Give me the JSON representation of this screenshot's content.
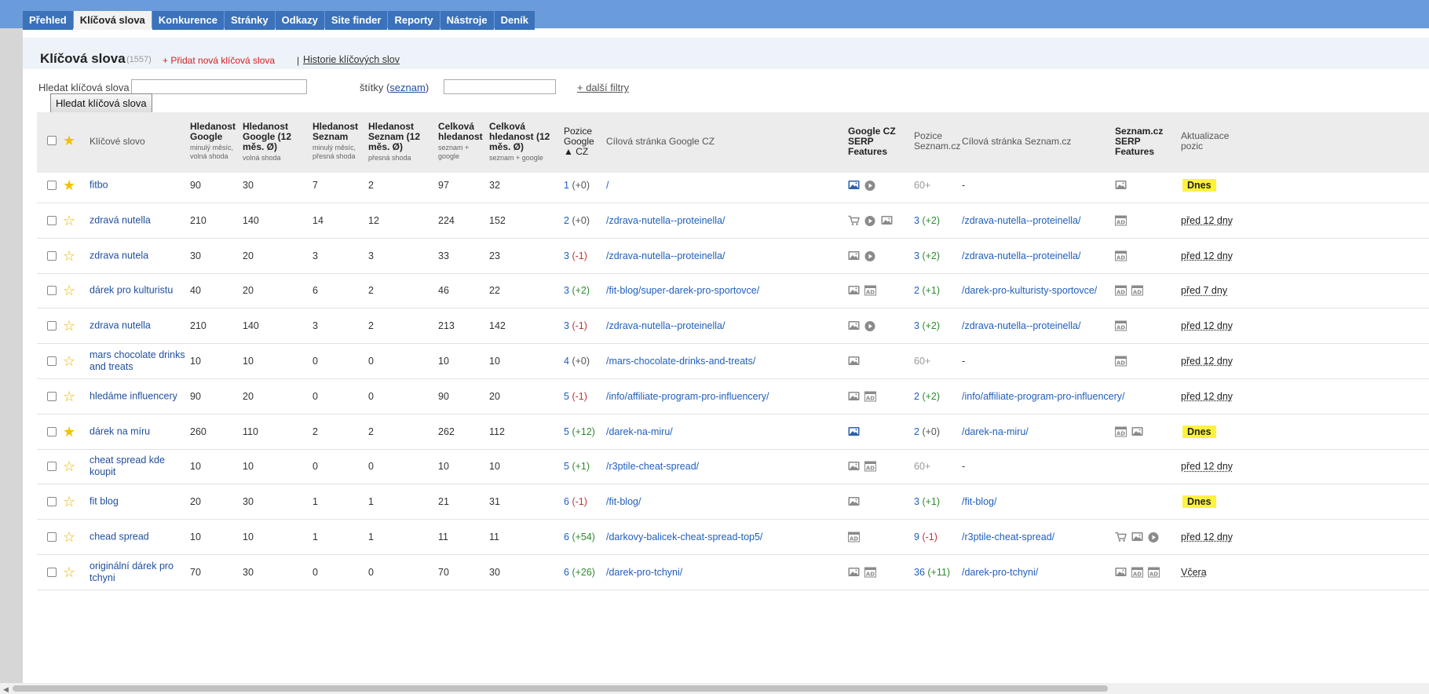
{
  "tabs": [
    {
      "label": "Přehled"
    },
    {
      "label": "Klíčová slova"
    },
    {
      "label": "Konkurence"
    },
    {
      "label": "Stránky"
    },
    {
      "label": "Odkazy"
    },
    {
      "label": "Site finder"
    },
    {
      "label": "Reporty"
    },
    {
      "label": "Nástroje"
    },
    {
      "label": "Deník"
    }
  ],
  "page": {
    "title": "Klíčová slova",
    "count": "(1557)",
    "add_link": "+ Přidat nová klíčová slova",
    "separator": "|",
    "history_link": "Historie klíčových slov"
  },
  "search": {
    "label": "Hledat klíčová slova",
    "value": "",
    "tags_label": "štítky (",
    "tags_link": "seznam",
    "tags_close": ")",
    "filters_link": "+ další filtry",
    "button": "Hledat klíčová slova"
  },
  "headers": {
    "keyword": "Klíčové slovo",
    "g_search": "Hledanost Google",
    "g_search_sub": "minulý měsíc, volná shoda",
    "g_search12": "Hledanost Google (12 měs. Ø)",
    "g_search12_sub": "volná shoda",
    "s_search": "Hledanost Seznam",
    "s_search_sub": "minulý měsíc, přesná shoda",
    "s_search12": "Hledanost Seznam (12 měs. Ø)",
    "s_search12_sub": "přesná shoda",
    "total": "Celková hledanost",
    "total_sub": "seznam + google",
    "total12": "Celková hledanost (12 měs. Ø)",
    "total12_sub": "seznam + google",
    "g_pos": "Pozice Google ▲ CZ",
    "g_target": "Cílová stránka Google CZ",
    "g_serp": "Google CZ SERP Features",
    "s_pos": "Pozice Seznam.cz",
    "s_target": "Cílová stránka Seznam.cz",
    "s_serp": "Seznam.cz SERP Features",
    "updated": "Aktualizace pozic"
  },
  "colors": {
    "topbar": "#6a9bdb",
    "tab": "#3b72b9",
    "link": "#1f5fbf",
    "negative": "#c83232",
    "positive": "#2f8a2f",
    "today_badge": "#fff23f"
  },
  "rows": [
    {
      "starred": true,
      "keyword": "fitbo",
      "g": "90",
      "g12": "30",
      "s": "7",
      "s12": "2",
      "t": "97",
      "t12": "32",
      "gpos": "1",
      "gdelta": "(+0)",
      "gsign": "zero",
      "gtarget": "/",
      "gicons": [
        "image-blue",
        "video"
      ],
      "spos": "60+",
      "sdelta": "",
      "ssign": "none",
      "starget": "-",
      "sicons": [
        "image"
      ],
      "updated": "Dnes",
      "today": true
    },
    {
      "starred": false,
      "keyword": "zdravá nutella",
      "g": "210",
      "g12": "140",
      "s": "14",
      "s12": "12",
      "t": "224",
      "t12": "152",
      "gpos": "2",
      "gdelta": "(+0)",
      "gsign": "zero",
      "gtarget": "/zdrava-nutella--proteinella/",
      "gicons": [
        "cart",
        "video",
        "image"
      ],
      "spos": "3",
      "sdelta": "(+2)",
      "ssign": "pos",
      "starget": "/zdrava-nutella--proteinella/",
      "sicons": [
        "ad"
      ],
      "updated": "před 12 dny",
      "today": false
    },
    {
      "starred": false,
      "keyword": "zdrava nutela",
      "g": "30",
      "g12": "20",
      "s": "3",
      "s12": "3",
      "t": "33",
      "t12": "23",
      "gpos": "3",
      "gdelta": "(-1)",
      "gsign": "neg",
      "gtarget": "/zdrava-nutella--proteinella/",
      "gicons": [
        "image",
        "video"
      ],
      "spos": "3",
      "sdelta": "(+2)",
      "ssign": "pos",
      "starget": "/zdrava-nutella--proteinella/",
      "sicons": [
        "ad"
      ],
      "updated": "před 12 dny",
      "today": false
    },
    {
      "starred": false,
      "keyword": "dárek pro kulturistu",
      "g": "40",
      "g12": "20",
      "s": "6",
      "s12": "2",
      "t": "46",
      "t12": "22",
      "gpos": "3",
      "gdelta": "(+2)",
      "gsign": "pos",
      "gtarget": "/fit-blog/super-darek-pro-sportovce/",
      "gicons": [
        "image",
        "ad"
      ],
      "spos": "2",
      "sdelta": "(+1)",
      "ssign": "pos",
      "starget": "/darek-pro-kulturisty-sportovce/",
      "sicons": [
        "ad",
        "ad"
      ],
      "updated": "před 7 dny",
      "today": false
    },
    {
      "starred": false,
      "keyword": "zdrava nutella",
      "g": "210",
      "g12": "140",
      "s": "3",
      "s12": "2",
      "t": "213",
      "t12": "142",
      "gpos": "3",
      "gdelta": "(-1)",
      "gsign": "neg",
      "gtarget": "/zdrava-nutella--proteinella/",
      "gicons": [
        "image",
        "video"
      ],
      "spos": "3",
      "sdelta": "(+2)",
      "ssign": "pos",
      "starget": "/zdrava-nutella--proteinella/",
      "sicons": [
        "ad"
      ],
      "updated": "před 12 dny",
      "today": false
    },
    {
      "starred": false,
      "keyword": "mars chocolate drinks and treats",
      "g": "10",
      "g12": "10",
      "s": "0",
      "s12": "0",
      "t": "10",
      "t12": "10",
      "gpos": "4",
      "gdelta": "(+0)",
      "gsign": "zero",
      "gtarget": "/mars-chocolate-drinks-and-treats/",
      "gicons": [
        "image"
      ],
      "spos": "60+",
      "sdelta": "",
      "ssign": "none",
      "starget": "-",
      "sicons": [
        "ad"
      ],
      "updated": "před 12 dny",
      "today": false
    },
    {
      "starred": false,
      "keyword": "hledáme influencery",
      "g": "90",
      "g12": "20",
      "s": "0",
      "s12": "0",
      "t": "90",
      "t12": "20",
      "gpos": "5",
      "gdelta": "(-1)",
      "gsign": "neg",
      "gtarget": "/info/affiliate-program-pro-influencery/",
      "gicons": [
        "image",
        "ad"
      ],
      "spos": "2",
      "sdelta": "(+2)",
      "ssign": "pos",
      "starget": "/info/affiliate-program-pro-influencery/",
      "sicons": [],
      "updated": "před 12 dny",
      "today": false
    },
    {
      "starred": true,
      "keyword": "dárek na míru",
      "g": "260",
      "g12": "110",
      "s": "2",
      "s12": "2",
      "t": "262",
      "t12": "112",
      "gpos": "5",
      "gdelta": "(+12)",
      "gsign": "pos",
      "gtarget": "/darek-na-miru/",
      "gicons": [
        "image-blue"
      ],
      "spos": "2",
      "sdelta": "(+0)",
      "ssign": "zero",
      "starget": "/darek-na-miru/",
      "sicons": [
        "ad",
        "image"
      ],
      "updated": "Dnes",
      "today": true
    },
    {
      "starred": false,
      "keyword": "cheat spread kde koupit",
      "g": "10",
      "g12": "10",
      "s": "0",
      "s12": "0",
      "t": "10",
      "t12": "10",
      "gpos": "5",
      "gdelta": "(+1)",
      "gsign": "pos",
      "gtarget": "/r3ptile-cheat-spread/",
      "gicons": [
        "image",
        "ad"
      ],
      "spos": "60+",
      "sdelta": "",
      "ssign": "none",
      "starget": "-",
      "sicons": [],
      "updated": "před 12 dny",
      "today": false
    },
    {
      "starred": false,
      "keyword": "fit blog",
      "g": "20",
      "g12": "30",
      "s": "1",
      "s12": "1",
      "t": "21",
      "t12": "31",
      "gpos": "6",
      "gdelta": "(-1)",
      "gsign": "neg",
      "gtarget": "/fit-blog/",
      "gicons": [
        "image"
      ],
      "spos": "3",
      "sdelta": "(+1)",
      "ssign": "pos",
      "starget": "/fit-blog/",
      "sicons": [],
      "updated": "Dnes",
      "today": true
    },
    {
      "starred": false,
      "keyword": "chead spread",
      "g": "10",
      "g12": "10",
      "s": "1",
      "s12": "1",
      "t": "11",
      "t12": "11",
      "gpos": "6",
      "gdelta": "(+54)",
      "gsign": "pos",
      "gtarget": "/darkovy-balicek-cheat-spread-top5/",
      "gicons": [
        "ad"
      ],
      "spos": "9",
      "sdelta": "(-1)",
      "ssign": "neg",
      "starget": "/r3ptile-cheat-spread/",
      "sicons": [
        "cart",
        "image",
        "video"
      ],
      "updated": "před 12 dny",
      "today": false
    },
    {
      "starred": false,
      "keyword": "originální dárek pro tchyni",
      "g": "70",
      "g12": "30",
      "s": "0",
      "s12": "0",
      "t": "70",
      "t12": "30",
      "gpos": "6",
      "gdelta": "(+26)",
      "gsign": "pos",
      "gtarget": "/darek-pro-tchyni/",
      "gicons": [
        "image",
        "ad"
      ],
      "spos": "36",
      "sdelta": "(+11)",
      "ssign": "pos",
      "starget": "/darek-pro-tchyni/",
      "sicons": [
        "image",
        "ad",
        "ad"
      ],
      "updated": "Včera",
      "today": false
    }
  ]
}
